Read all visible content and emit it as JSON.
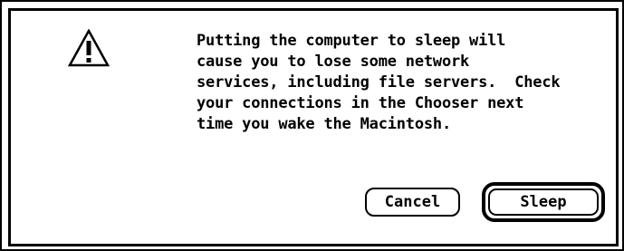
{
  "dialog": {
    "icon": "caution-icon",
    "message_lines": [
      "Putting the computer to sleep will",
      "cause you to lose some network",
      "services, including file servers.  Check",
      "your connections in the Chooser next",
      "time you wake the Macintosh."
    ],
    "buttons": {
      "cancel_label": "Cancel",
      "sleep_label": "Sleep",
      "default": "Sleep"
    }
  }
}
